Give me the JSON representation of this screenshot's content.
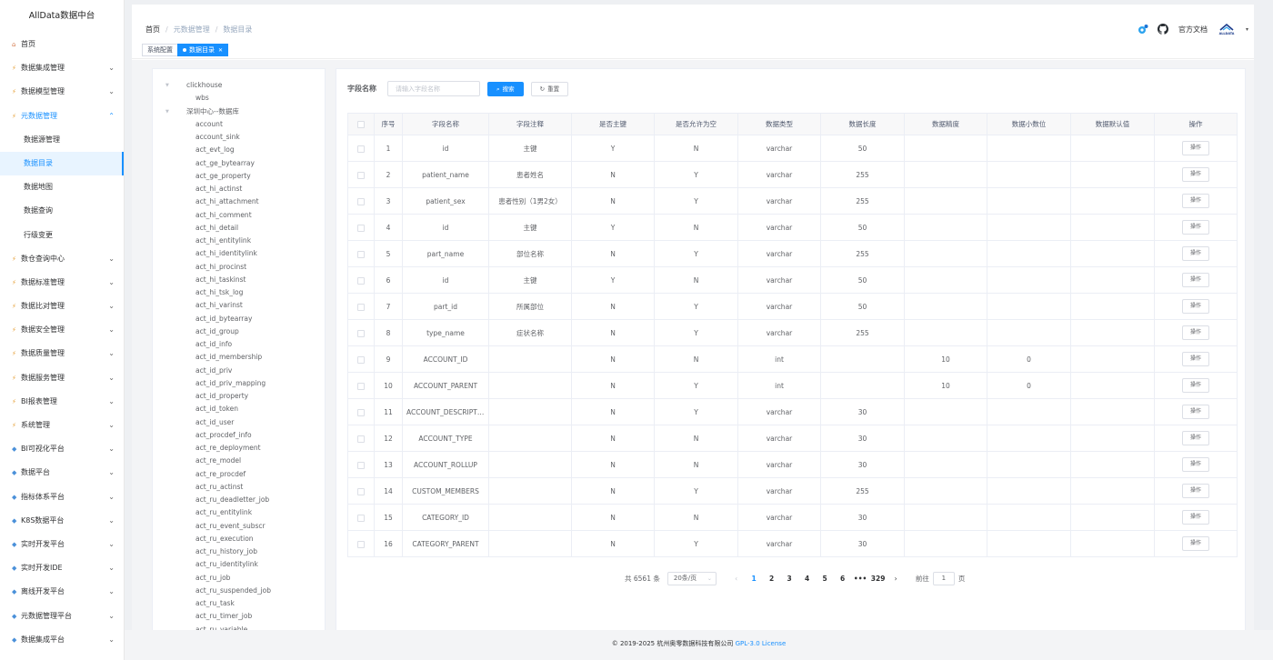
{
  "app": {
    "title": "AllData数据中台"
  },
  "sidebar": {
    "items": [
      {
        "label": "首页",
        "icon": "home-icon",
        "expandable": false
      },
      {
        "label": "数据集成管理",
        "icon": "module-icon",
        "expandable": true
      },
      {
        "label": "数据模型管理",
        "icon": "module-icon",
        "expandable": true
      },
      {
        "label": "元数据管理",
        "icon": "module-icon",
        "expandable": true,
        "open": true
      },
      {
        "label": "数仓查询中心",
        "icon": "module-icon",
        "expandable": true
      },
      {
        "label": "数据标准管理",
        "icon": "module-icon",
        "expandable": true
      },
      {
        "label": "数据比对管理",
        "icon": "module-icon",
        "expandable": true
      },
      {
        "label": "数据安全管理",
        "icon": "module-icon",
        "expandable": true
      },
      {
        "label": "数据质量管理",
        "icon": "module-icon",
        "expandable": true
      },
      {
        "label": "数据服务管理",
        "icon": "module-icon",
        "expandable": true
      },
      {
        "label": "BI报表管理",
        "icon": "module-icon",
        "expandable": true
      },
      {
        "label": "系统管理",
        "icon": "module-icon",
        "expandable": true
      },
      {
        "label": "BI可视化平台",
        "icon": "platform-icon",
        "expandable": true
      },
      {
        "label": "数据平台",
        "icon": "platform-icon",
        "expandable": true
      },
      {
        "label": "指标体系平台",
        "icon": "platform-icon",
        "expandable": true
      },
      {
        "label": "K8S数据平台",
        "icon": "platform-icon",
        "expandable": true
      },
      {
        "label": "实时开发平台",
        "icon": "platform-icon",
        "expandable": true
      },
      {
        "label": "实时开发IDE",
        "icon": "platform-icon",
        "expandable": true
      },
      {
        "label": "离线开发平台",
        "icon": "platform-icon",
        "expandable": true
      },
      {
        "label": "元数据管理平台",
        "icon": "platform-icon",
        "expandable": true
      },
      {
        "label": "数据集成平台",
        "icon": "platform-icon",
        "expandable": true
      }
    ],
    "submenu": [
      "数据源管理",
      "数据目录",
      "数据地图",
      "数据查询",
      "行级变更"
    ],
    "active_submenu": "数据目录"
  },
  "header": {
    "breadcrumb": [
      "首页",
      "元数据管理",
      "数据目录"
    ],
    "docs_label": "官方文档",
    "avatar_text": "ALLDATA"
  },
  "tags": [
    {
      "label": "系统配置",
      "active": false
    },
    {
      "label": "数据目录",
      "active": true
    }
  ],
  "tree": {
    "roots": [
      {
        "label": "clickhouse",
        "children": [
          "wbs"
        ]
      },
      {
        "label": "深圳中心--数据库",
        "children": [
          "account",
          "account_sink",
          "act_evt_log",
          "act_ge_bytearray",
          "act_ge_property",
          "act_hi_actinst",
          "act_hi_attachment",
          "act_hi_comment",
          "act_hi_detail",
          "act_hi_entitylink",
          "act_hi_identitylink",
          "act_hi_procinst",
          "act_hi_taskinst",
          "act_hi_tsk_log",
          "act_hi_varinst",
          "act_id_bytearray",
          "act_id_group",
          "act_id_info",
          "act_id_membership",
          "act_id_priv",
          "act_id_priv_mapping",
          "act_id_property",
          "act_id_token",
          "act_id_user",
          "act_procdef_info",
          "act_re_deployment",
          "act_re_model",
          "act_re_procdef",
          "act_ru_actinst",
          "act_ru_deadletter_job",
          "act_ru_entitylink",
          "act_ru_event_subscr",
          "act_ru_execution",
          "act_ru_history_job",
          "act_ru_identitylink",
          "act_ru_job",
          "act_ru_suspended_job",
          "act_ru_task",
          "act_ru_timer_job",
          "act_ru_variable"
        ]
      }
    ]
  },
  "search": {
    "label": "字段名称",
    "placeholder": "请输入字段名称",
    "search_btn": "搜索",
    "reset_btn": "重置"
  },
  "table": {
    "columns": [
      "序号",
      "字段名称",
      "字段注释",
      "是否主键",
      "是否允许为空",
      "数据类型",
      "数据长度",
      "数据精度",
      "数据小数位",
      "数据默认值",
      "操作"
    ],
    "op_label": "操作",
    "rows": [
      [
        "1",
        "id",
        "主键",
        "Y",
        "N",
        "varchar",
        "50",
        "",
        "",
        ""
      ],
      [
        "2",
        "patient_name",
        "患者姓名",
        "N",
        "Y",
        "varchar",
        "255",
        "",
        "",
        ""
      ],
      [
        "3",
        "patient_sex",
        "患者性别（1男2女）",
        "N",
        "Y",
        "varchar",
        "255",
        "",
        "",
        ""
      ],
      [
        "4",
        "id",
        "主键",
        "Y",
        "N",
        "varchar",
        "50",
        "",
        "",
        ""
      ],
      [
        "5",
        "part_name",
        "部位名称",
        "N",
        "Y",
        "varchar",
        "255",
        "",
        "",
        ""
      ],
      [
        "6",
        "id",
        "主键",
        "Y",
        "N",
        "varchar",
        "50",
        "",
        "",
        ""
      ],
      [
        "7",
        "part_id",
        "所属部位",
        "N",
        "Y",
        "varchar",
        "50",
        "",
        "",
        ""
      ],
      [
        "8",
        "type_name",
        "症状名称",
        "N",
        "Y",
        "varchar",
        "255",
        "",
        "",
        ""
      ],
      [
        "9",
        "ACCOUNT_ID",
        "",
        "N",
        "N",
        "int",
        "",
        "10",
        "0",
        ""
      ],
      [
        "10",
        "ACCOUNT_PARENT",
        "",
        "N",
        "Y",
        "int",
        "",
        "10",
        "0",
        ""
      ],
      [
        "11",
        "ACCOUNT_DESCRIPTION",
        "",
        "N",
        "Y",
        "varchar",
        "30",
        "",
        "",
        ""
      ],
      [
        "12",
        "ACCOUNT_TYPE",
        "",
        "N",
        "N",
        "varchar",
        "30",
        "",
        "",
        ""
      ],
      [
        "13",
        "ACCOUNT_ROLLUP",
        "",
        "N",
        "N",
        "varchar",
        "30",
        "",
        "",
        ""
      ],
      [
        "14",
        "CUSTOM_MEMBERS",
        "",
        "N",
        "Y",
        "varchar",
        "255",
        "",
        "",
        ""
      ],
      [
        "15",
        "CATEGORY_ID",
        "",
        "N",
        "N",
        "varchar",
        "30",
        "",
        "",
        ""
      ],
      [
        "16",
        "CATEGORY_PARENT",
        "",
        "N",
        "Y",
        "varchar",
        "30",
        "",
        "",
        ""
      ]
    ]
  },
  "pagination": {
    "total": "共 6561 条",
    "page_size": "20条/页",
    "pages": [
      "1",
      "2",
      "3",
      "4",
      "5",
      "6",
      "•••",
      "329"
    ],
    "active": "1",
    "goto_label": "前往",
    "goto_value": "1",
    "page_unit": "页"
  },
  "footer": {
    "text": "© 2019-2025 杭州奥零数据科技有限公司",
    "link": "GPL-3.0 License"
  },
  "colors": {
    "primary": "#1890ff",
    "sidebar_icon": "#e6a23c"
  }
}
